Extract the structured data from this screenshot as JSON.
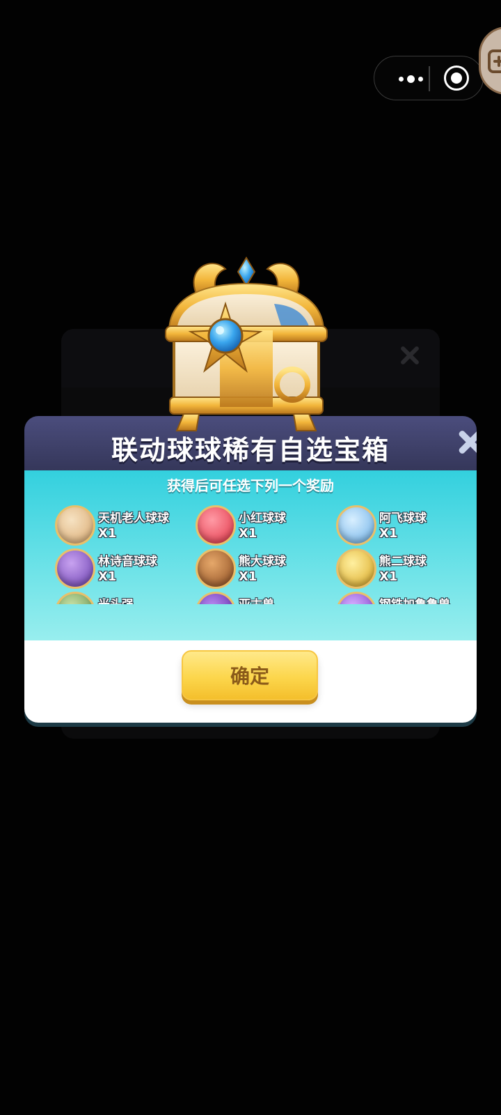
{
  "capsule": {
    "more_icon": "more-dots-icon",
    "close_icon": "target-circle-icon"
  },
  "background_panel": {
    "close_icon": "close-x-icon"
  },
  "dialog": {
    "title": "联动球球稀有自选宝箱",
    "subtitle": "获得后可任选下列一个奖励",
    "confirm_label": "确定",
    "colors": {
      "header": "#3d3f66",
      "body_top": "#33d0de",
      "body_bottom": "#98eeee",
      "button": "#fcd64c"
    }
  },
  "rewards": [
    {
      "name": "天机老人球球",
      "qty": "X1",
      "color": "#e6c59a"
    },
    {
      "name": "小红球球",
      "qty": "X1",
      "color": "#ef4a5a"
    },
    {
      "name": "阿飞球球",
      "qty": "X1",
      "color": "#8fc8ef"
    },
    {
      "name": "林诗音球球",
      "qty": "X1",
      "color": "#8a5fc9"
    },
    {
      "name": "熊大球球",
      "qty": "X1",
      "color": "#b06a35"
    },
    {
      "name": "熊二球球",
      "qty": "X1",
      "color": "#e6c13f"
    },
    {
      "name": "光头强",
      "qty": "",
      "color": "#7fa56a"
    },
    {
      "name": "亚古兽",
      "qty": "",
      "color": "#7a3fc4"
    },
    {
      "name": "钢铁加鲁鲁兽",
      "qty": "",
      "color": "#9b5fd6"
    }
  ]
}
